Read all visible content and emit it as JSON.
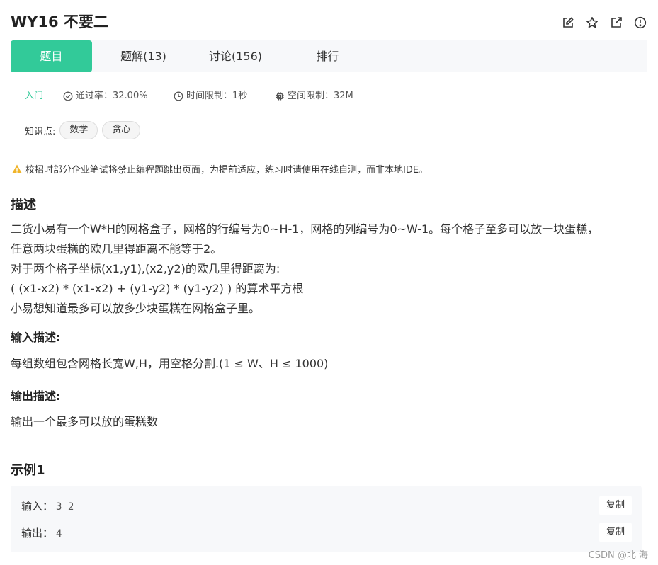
{
  "header": {
    "title": "WY16  不要二",
    "actions": [
      {
        "name": "edit-icon"
      },
      {
        "name": "star-icon"
      },
      {
        "name": "external-link-icon"
      },
      {
        "name": "info-icon"
      }
    ]
  },
  "tabs": [
    {
      "label": "题目",
      "active": true
    },
    {
      "label": "题解(13)",
      "active": false
    },
    {
      "label": "讨论(156)",
      "active": false
    },
    {
      "label": "排行",
      "active": false
    }
  ],
  "meta": {
    "level": "入门",
    "pass_rate": "通过率：32.00%",
    "time_limit": "时间限制：1秒",
    "space_limit": "空间限制：32M"
  },
  "knowledge": {
    "label": "知识点:",
    "tags": [
      "数学",
      "贪心"
    ]
  },
  "notice": "校招时部分企业笔试将禁止编程题跳出页面，为提前适应，练习时请使用在线自测，而非本地IDE。",
  "description": {
    "title": "描述",
    "lines": [
      "二货小易有一个W*H的网格盒子，网格的行编号为0~H-1，网格的列编号为0~W-1。每个格子至多可以放一块蛋糕，",
      "任意两块蛋糕的欧几里得距离不能等于2。",
      "对于两个格子坐标(x1,y1),(x2,y2)的欧几里得距离为:",
      "( (x1-x2) * (x1-x2) + (y1-y2) * (y1-y2) ) 的算术平方根",
      "小易想知道最多可以放多少块蛋糕在网格盒子里。"
    ]
  },
  "input_desc": {
    "title": "输入描述:",
    "text": "每组数组包含网格长宽W,H，用空格分割.(1 ≤ W、H ≤ 1000)"
  },
  "output_desc": {
    "title": "输出描述:",
    "text": "输出一个最多可以放的蛋糕数"
  },
  "example": {
    "title": "示例1",
    "input_label": "输入：",
    "input_value": "3 2",
    "output_label": "输出：",
    "output_value": "4",
    "copy_label": "复制"
  },
  "watermark": "CSDN @北  海",
  "colors": {
    "accent": "#32ca99",
    "warning": "#f0b429",
    "tab_bg": "#f7f8fa"
  }
}
